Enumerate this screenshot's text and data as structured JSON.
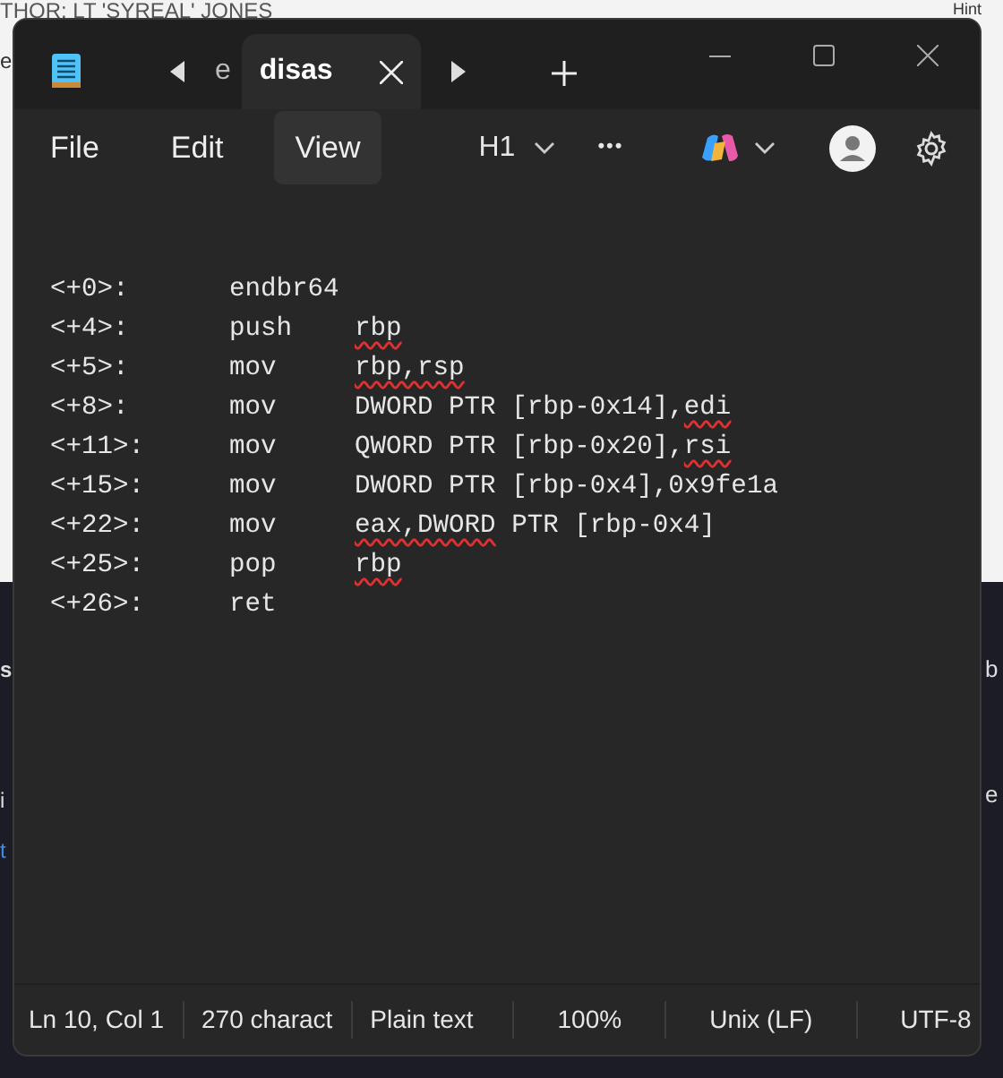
{
  "background_page": {
    "top_left_text": "THOR: LT 'SYREAL' JONES",
    "top_right_text": "Hint",
    "left_edge": [
      "e",
      "s",
      "i",
      "t"
    ],
    "right_edge": [
      "b",
      "e"
    ]
  },
  "window": {
    "tabs": [
      {
        "label": "e",
        "selected": false
      },
      {
        "label": "disas",
        "selected": true
      }
    ]
  },
  "menu": [
    {
      "label": "File",
      "selected": false
    },
    {
      "label": "Edit",
      "selected": false
    },
    {
      "label": "View",
      "selected": true
    }
  ],
  "toolbar": {
    "heading": "H1",
    "more": "•••"
  },
  "lines": [
    {
      "offset": "<+0>:",
      "mnemonic": "endbr64"
    },
    {
      "offset": "<+4>:",
      "mnemonic": "push",
      "operands": [
        {
          "text": "rbp",
          "flagged": true
        }
      ]
    },
    {
      "offset": "<+5>:",
      "mnemonic": "mov",
      "operands": [
        {
          "text": "rbp,rsp",
          "flagged": true
        }
      ]
    },
    {
      "offset": "<+8>:",
      "mnemonic": "mov",
      "operands": [
        {
          "text": "DWORD PTR [rbp-0x14],",
          "flagged": false
        },
        {
          "text": "edi",
          "flagged": true
        }
      ]
    },
    {
      "offset": "<+11>:",
      "mnemonic": "mov",
      "operands": [
        {
          "text": "QWORD PTR [rbp-0x20],",
          "flagged": false
        },
        {
          "text": "rsi",
          "flagged": true
        }
      ]
    },
    {
      "offset": "<+15>:",
      "mnemonic": "mov",
      "operands": [
        {
          "text": "DWORD PTR [rbp-0x4],0x9fe1a",
          "flagged": false
        }
      ]
    },
    {
      "offset": "<+22>:",
      "mnemonic": "mov",
      "operands": [
        {
          "text": "eax,DWORD",
          "flagged": true
        },
        {
          "text": " PTR [rbp-0x4]",
          "flagged": false
        }
      ]
    },
    {
      "offset": "<+25>:",
      "mnemonic": "pop",
      "operands": [
        {
          "text": "rbp",
          "flagged": true
        }
      ]
    },
    {
      "offset": "<+26>:",
      "mnemonic": "ret"
    }
  ],
  "status_bar": [
    "Ln 10, Col 1",
    "270 charact",
    "Plain text",
    "100%",
    "Unix (LF)",
    "UTF-8"
  ]
}
